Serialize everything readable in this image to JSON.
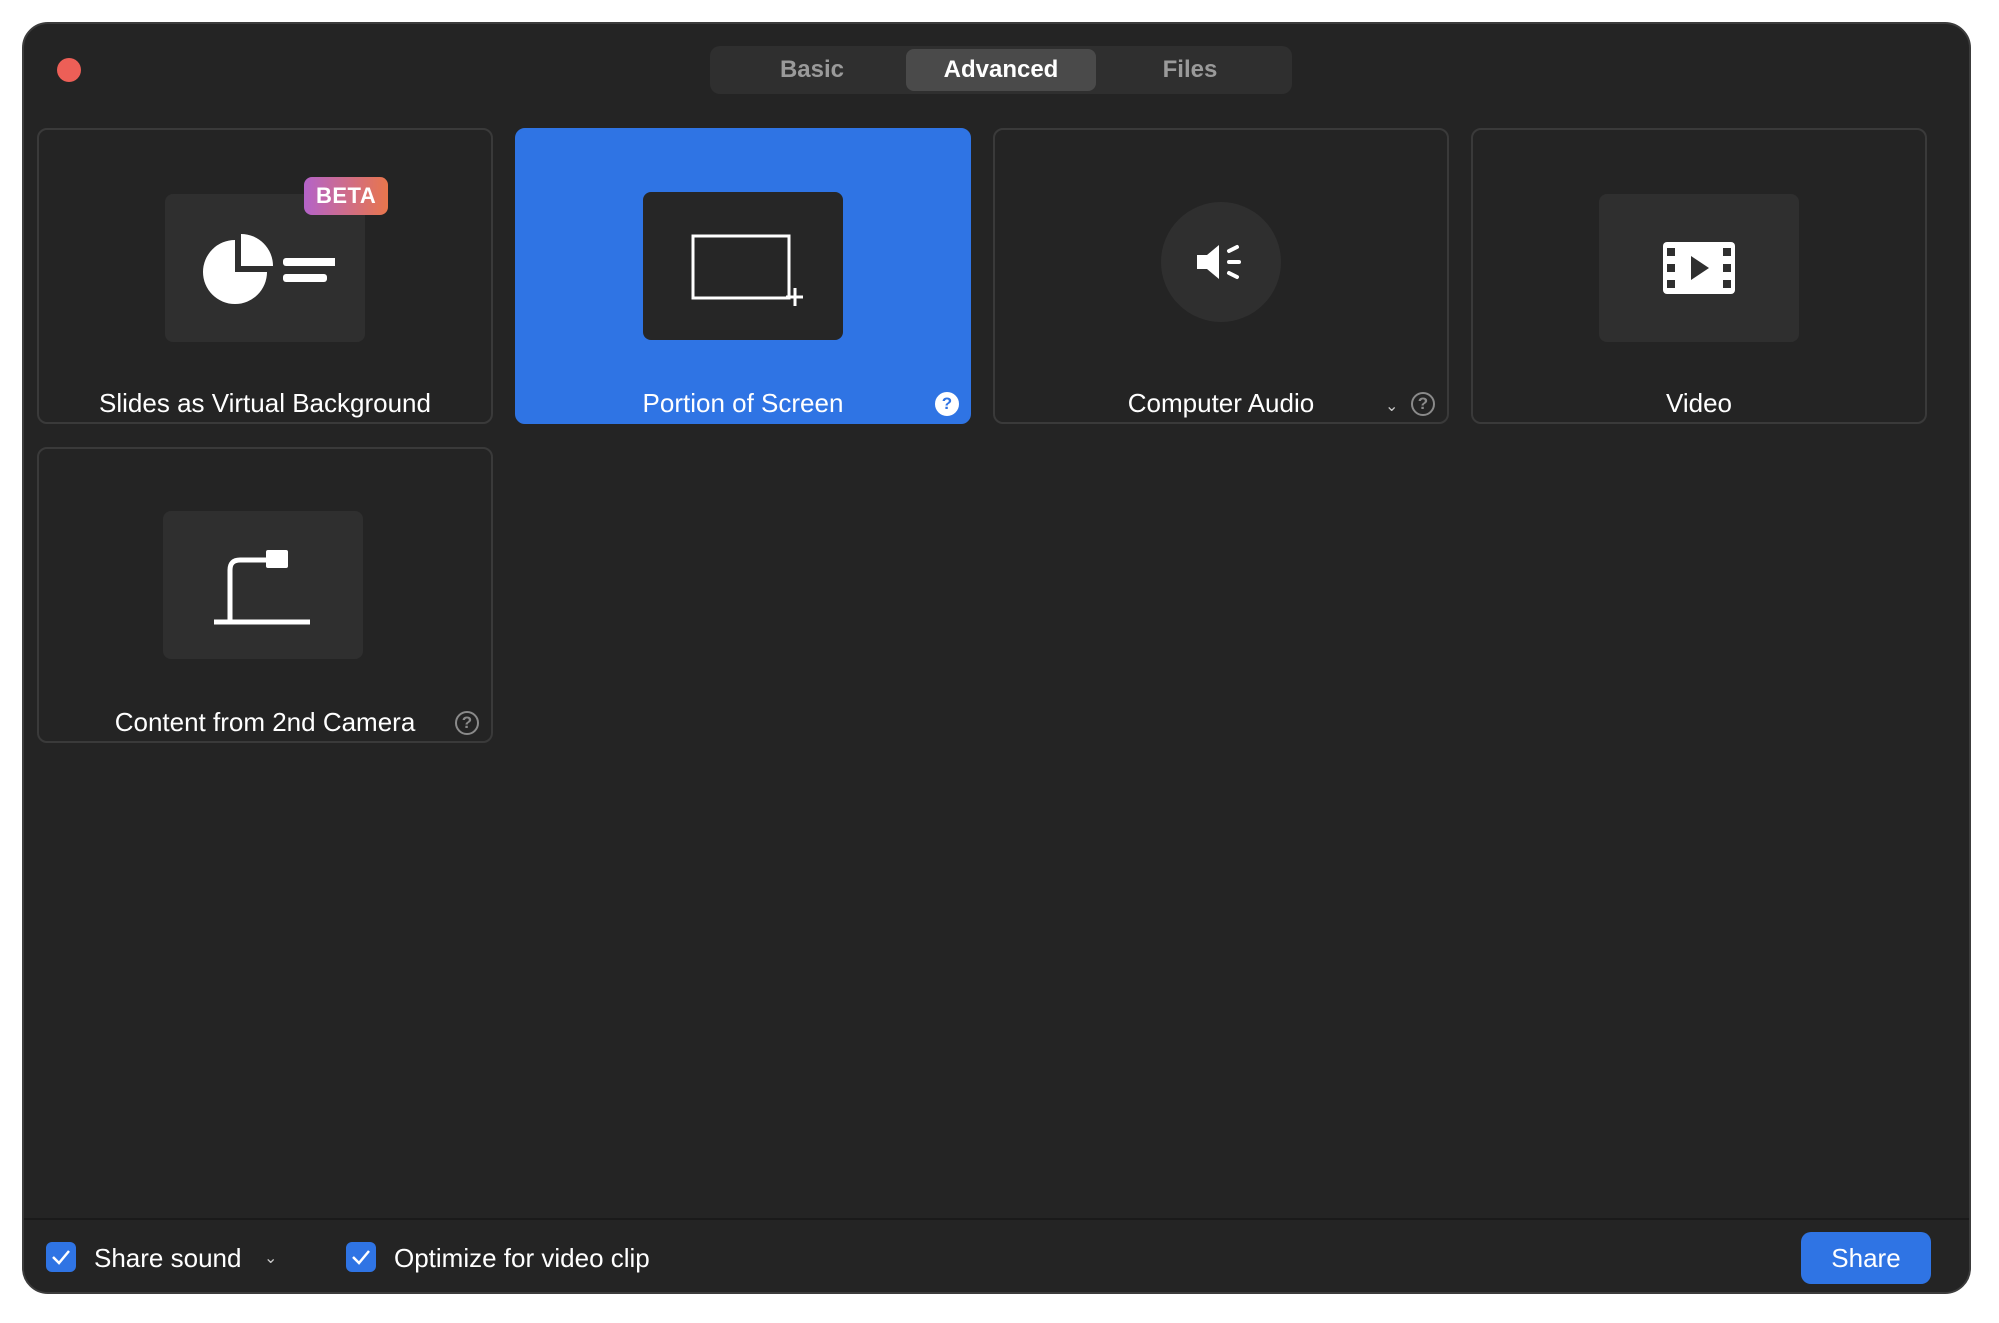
{
  "tabs": [
    {
      "label": "Basic",
      "active": false
    },
    {
      "label": "Advanced",
      "active": true
    },
    {
      "label": "Files",
      "active": false
    }
  ],
  "tiles": [
    {
      "label": "Slides as Virtual Background",
      "icon": "slides-pie-chart-icon",
      "badge": "BETA",
      "selected": false
    },
    {
      "label": "Portion of Screen",
      "icon": "screen-portion-icon",
      "selected": true,
      "help": true
    },
    {
      "label": "Computer Audio",
      "icon": "speaker-icon",
      "selected": false,
      "help": true,
      "dropdown": true
    },
    {
      "label": "Video",
      "icon": "film-play-icon",
      "selected": false
    },
    {
      "label": "Content from 2nd Camera",
      "icon": "document-camera-icon",
      "selected": false,
      "help": true
    }
  ],
  "help_glyph": "?",
  "footer": {
    "share_sound_label": "Share sound",
    "share_sound_checked": true,
    "optimize_label": "Optimize for video clip",
    "optimize_checked": true,
    "share_button_label": "Share"
  },
  "colors": {
    "accent": "#2f74e4",
    "window_bg": "#242424",
    "close_button": "#ed5f57"
  }
}
